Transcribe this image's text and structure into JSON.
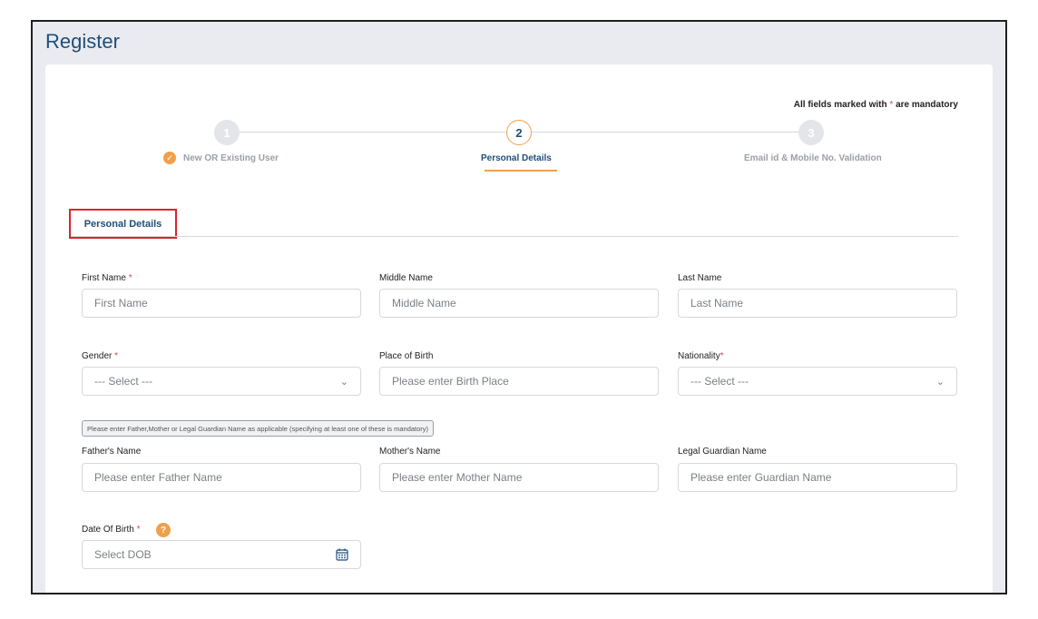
{
  "page": {
    "title": "Register"
  },
  "note": {
    "prefix": "All fields marked with ",
    "star": "*",
    "suffix": " are mandatory"
  },
  "stepper": {
    "steps": [
      {
        "number": "1",
        "label": "New OR Existing User",
        "state": "done"
      },
      {
        "number": "2",
        "label": "Personal Details",
        "state": "active"
      },
      {
        "number": "3",
        "label": "Email id & Mobile No. Validation",
        "state": "todo"
      }
    ]
  },
  "section": {
    "tab": "Personal Details"
  },
  "fields": {
    "first_name": {
      "label": "First Name",
      "required": "*",
      "placeholder": "First Name"
    },
    "middle_name": {
      "label": "Middle Name",
      "placeholder": "Middle Name"
    },
    "last_name": {
      "label": "Last Name",
      "placeholder": "Last Name"
    },
    "gender": {
      "label": "Gender",
      "required": "*",
      "value": "--- Select ---"
    },
    "place_of_birth": {
      "label": "Place of Birth",
      "placeholder": "Please enter Birth Place"
    },
    "nationality": {
      "label": "Nationality",
      "required": "*",
      "value": "--- Select ---"
    },
    "guardian_note": "Please enter Father,Mother or Legal Guardian Name as applicable (specifying at least one of these is mandatory)",
    "father_name": {
      "label": "Father's Name",
      "placeholder": "Please enter Father Name"
    },
    "mother_name": {
      "label": "Mother's Name",
      "placeholder": "Please enter Mother Name"
    },
    "guardian_name": {
      "label": "Legal Guardian Name",
      "placeholder": "Please enter Guardian Name"
    },
    "dob": {
      "label": "Date Of Birth",
      "required": "*",
      "help": "?",
      "placeholder": "Select DOB"
    }
  },
  "colors": {
    "accent": "#f0a04b",
    "brand": "#1f4e79",
    "required": "#e0434f",
    "highlight": "#d8262b"
  }
}
